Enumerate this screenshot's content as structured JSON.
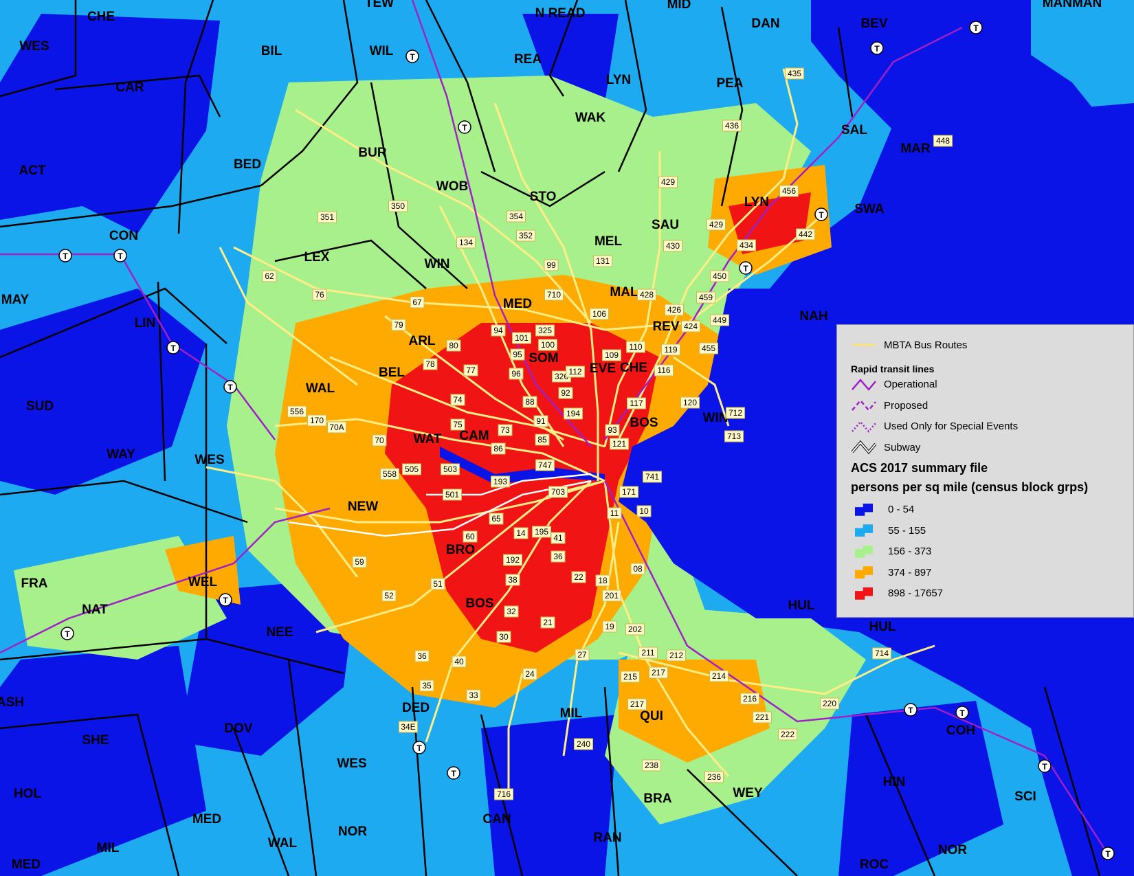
{
  "map": {
    "colors": {
      "water": "#0a14e6",
      "bin_0_54": "#0a14e6",
      "bin_55_155": "#1eaaf0",
      "bin_156_373": "#a8f08c",
      "bin_374_897": "#ffaa00",
      "bin_898_17657": "#f01414",
      "bus_route": "#ffee88",
      "rapid_transit": "#a020c8",
      "subway": "#ffffff",
      "town_boundary": "#000000"
    },
    "towns": [
      "CHE",
      "WES",
      "BIL",
      "TEW",
      "WIL",
      "N READ",
      "MID",
      "DAN",
      "BEV",
      "MANMAN",
      "CAR",
      "REA",
      "LYN",
      "PEA",
      "WAK",
      "SAL",
      "BUR",
      "MAR",
      "BED",
      "WOB",
      "STO",
      "SWA",
      "ACT",
      "CON",
      "LEX",
      "WIN",
      "MEL",
      "SAU",
      "LYN",
      "MAY",
      "MAL",
      "NAH",
      "MED",
      "REV",
      "LIN",
      "ARL",
      "SOM",
      "EVE",
      "CHE",
      "BEL",
      "SUD",
      "WAL",
      "WAT",
      "CAM",
      "BOS",
      "WIN",
      "WAY",
      "WES",
      "NEW",
      "BRO",
      "FRA",
      "WEL",
      "NAT",
      "NEE",
      "BOS",
      "HUL",
      "HUL",
      "ASH",
      "DED",
      "DOV",
      "SHE",
      "MIL",
      "QUI",
      "COH",
      "HIN",
      "WES",
      "HOL",
      "MED",
      "NOR",
      "CAN",
      "BRA",
      "WEY",
      "SCI",
      "MIL",
      "WAL",
      "RAN",
      "NOR",
      "ROC",
      "MED"
    ],
    "routes": [
      "435",
      "436",
      "448",
      "456",
      "442",
      "434",
      "429",
      "430",
      "450",
      "459",
      "449",
      "455",
      "424",
      "426",
      "428",
      "429",
      "351",
      "350",
      "354",
      "352",
      "134",
      "62",
      "76",
      "67",
      "79",
      "80",
      "78",
      "77",
      "94",
      "101",
      "95",
      "96",
      "325",
      "100",
      "326",
      "112",
      "92",
      "88",
      "106",
      "109",
      "110",
      "116",
      "117",
      "119",
      "120",
      "712",
      "713",
      "99",
      "710",
      "131",
      "556",
      "170",
      "70A",
      "70",
      "74",
      "75",
      "73",
      "86",
      "85",
      "91",
      "194",
      "93",
      "121",
      "747",
      "558",
      "505",
      "503",
      "193",
      "501",
      "703",
      "171",
      "741",
      "11",
      "10",
      "65",
      "60",
      "59",
      "14",
      "195",
      "41",
      "192",
      "38",
      "36",
      "22",
      "18",
      "201",
      "52",
      "51",
      "32",
      "21",
      "19",
      "202",
      "30",
      "08",
      "36",
      "40",
      "35",
      "33",
      "34E",
      "24",
      "27",
      "211",
      "212",
      "217",
      "215",
      "217",
      "214",
      "216",
      "221",
      "220",
      "222",
      "714",
      "240",
      "238",
      "236",
      "716"
    ]
  },
  "legend": {
    "bus_routes_label": "MBTA Bus Routes",
    "rapid_header": "Rapid transit lines",
    "operational": "Operational",
    "proposed": "Proposed",
    "special_events": "Used Only for Special Events",
    "subway": "Subway",
    "title_line1": "ACS 2017 summary file",
    "title_line2": "persons per sq mile (census block grps)",
    "bins": [
      "0 - 54",
      "55 - 155",
      "156 - 373",
      "374 - 897",
      "898 - 17657"
    ]
  }
}
